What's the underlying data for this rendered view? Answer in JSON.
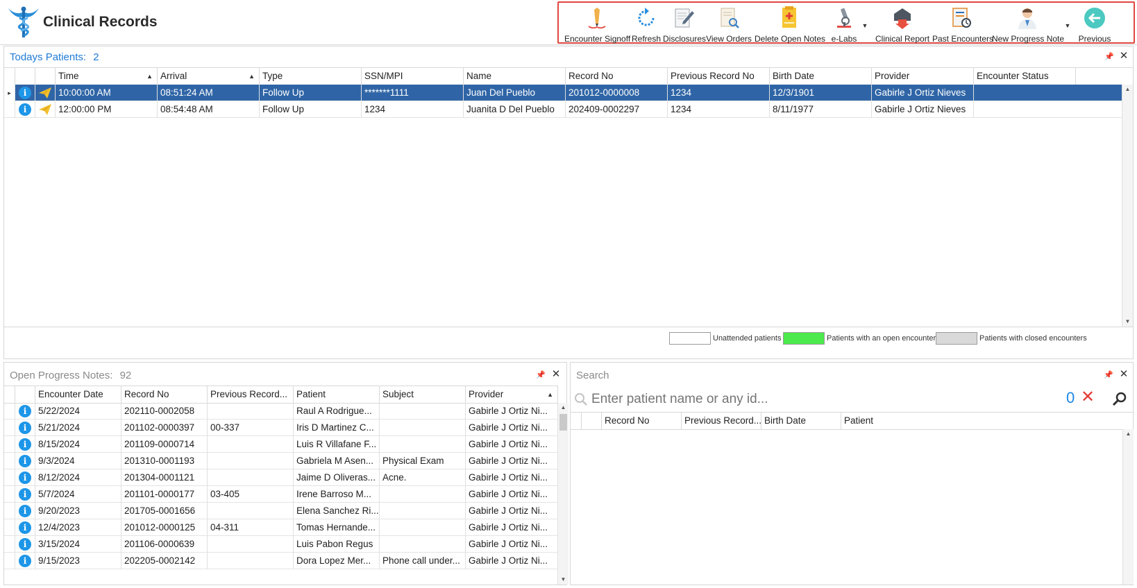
{
  "app": {
    "title": "Clinical Records"
  },
  "toolbar": {
    "encounter_signoff": "Encounter Signoff",
    "refresh": "Refresh",
    "disclosures": "Disclosures",
    "view_orders": "View Orders",
    "delete_open_notes": "Delete Open Notes",
    "elabs": "e-Labs",
    "clinical_report": "Clinical Report",
    "past_encounters": "Past Encounters",
    "new_progress_note": "New Progress Note",
    "previous": "Previous"
  },
  "todays": {
    "title": "Todays Patients:",
    "count": "2",
    "columns": [
      "Time",
      "Arrival",
      "Type",
      "SSN/MPI",
      "Name",
      "Record No",
      "Previous Record No",
      "Birth Date",
      "Provider",
      "Encounter Status"
    ],
    "rows": [
      {
        "time": "10:00:00 AM",
        "arrival": "08:51:24 AM",
        "type": "Follow Up",
        "ssn": "*******1111",
        "name": "Juan Del Pueblo",
        "record": "201012-0000008",
        "prev": "1234",
        "birth": "12/3/1901",
        "provider": "Gabirle J Ortiz Nieves",
        "status": ""
      },
      {
        "time": "12:00:00 PM",
        "arrival": "08:54:48 AM",
        "type": "Follow Up",
        "ssn": "1234",
        "name": "Juanita D Del Pueblo",
        "record": "202409-0002297",
        "prev": "1234",
        "birth": "8/11/1977",
        "provider": "Gabirle J Ortiz Nieves",
        "status": ""
      }
    ],
    "legend": {
      "unattended": "Unattended patients",
      "open": "Patients with an open encounter",
      "closed": "Patients with closed encounters"
    }
  },
  "notes": {
    "title": "Open Progress Notes:",
    "count": "92",
    "columns": [
      "Encounter Date",
      "Record No",
      "Previous Record...",
      "Patient",
      "Subject",
      "Provider"
    ],
    "rows": [
      {
        "date": "5/22/2024",
        "record": "202110-0002058",
        "prev": "",
        "patient": "Raul A Rodrigue...",
        "subject": "",
        "provider": "Gabirle J Ortiz Ni..."
      },
      {
        "date": "5/21/2024",
        "record": "201102-0000397",
        "prev": "00-337",
        "patient": "Iris D Martinez C...",
        "subject": "",
        "provider": "Gabirle J Ortiz Ni..."
      },
      {
        "date": "8/15/2024",
        "record": "201109-0000714",
        "prev": "",
        "patient": "Luis R Villafane F...",
        "subject": "",
        "provider": "Gabirle J Ortiz Ni..."
      },
      {
        "date": "9/3/2024",
        "record": "201310-0001193",
        "prev": "",
        "patient": "Gabriela M Asen...",
        "subject": "Physical Exam",
        "provider": "Gabirle J Ortiz Ni..."
      },
      {
        "date": "8/12/2024",
        "record": "201304-0001121",
        "prev": "",
        "patient": "Jaime D Oliveras...",
        "subject": "Acne.",
        "provider": "Gabirle J Ortiz Ni..."
      },
      {
        "date": "5/7/2024",
        "record": "201101-0000177",
        "prev": "03-405",
        "patient": "Irene Barroso M...",
        "subject": "",
        "provider": "Gabirle J Ortiz Ni..."
      },
      {
        "date": "9/20/2023",
        "record": "201705-0001656",
        "prev": "",
        "patient": "Elena Sanchez Ri...",
        "subject": "",
        "provider": "Gabirle J Ortiz Ni..."
      },
      {
        "date": "12/4/2023",
        "record": "201012-0000125",
        "prev": "04-311",
        "patient": "Tomas Hernande...",
        "subject": "",
        "provider": "Gabirle J Ortiz Ni..."
      },
      {
        "date": "3/15/2024",
        "record": "201106-0000639",
        "prev": "",
        "patient": "Luis Pabon Regus",
        "subject": "",
        "provider": "Gabirle J Ortiz Ni..."
      },
      {
        "date": "9/15/2023",
        "record": "202205-0002142",
        "prev": "",
        "patient": "Dora Lopez Mer...",
        "subject": "Phone call under...",
        "provider": "Gabirle J Ortiz Ni..."
      }
    ]
  },
  "search": {
    "title": "Search",
    "placeholder": "Enter patient name or any id...",
    "count": "0",
    "columns": [
      "Record No",
      "Previous Record...",
      "Birth Date",
      "Patient"
    ]
  },
  "colors": {
    "accent": "#1e7bd6",
    "selected_row": "#2f65a6",
    "open_encounter": "#4cea4c",
    "closed_encounter": "#d9d9d9",
    "toolbar_highlight": "#e0463f"
  }
}
